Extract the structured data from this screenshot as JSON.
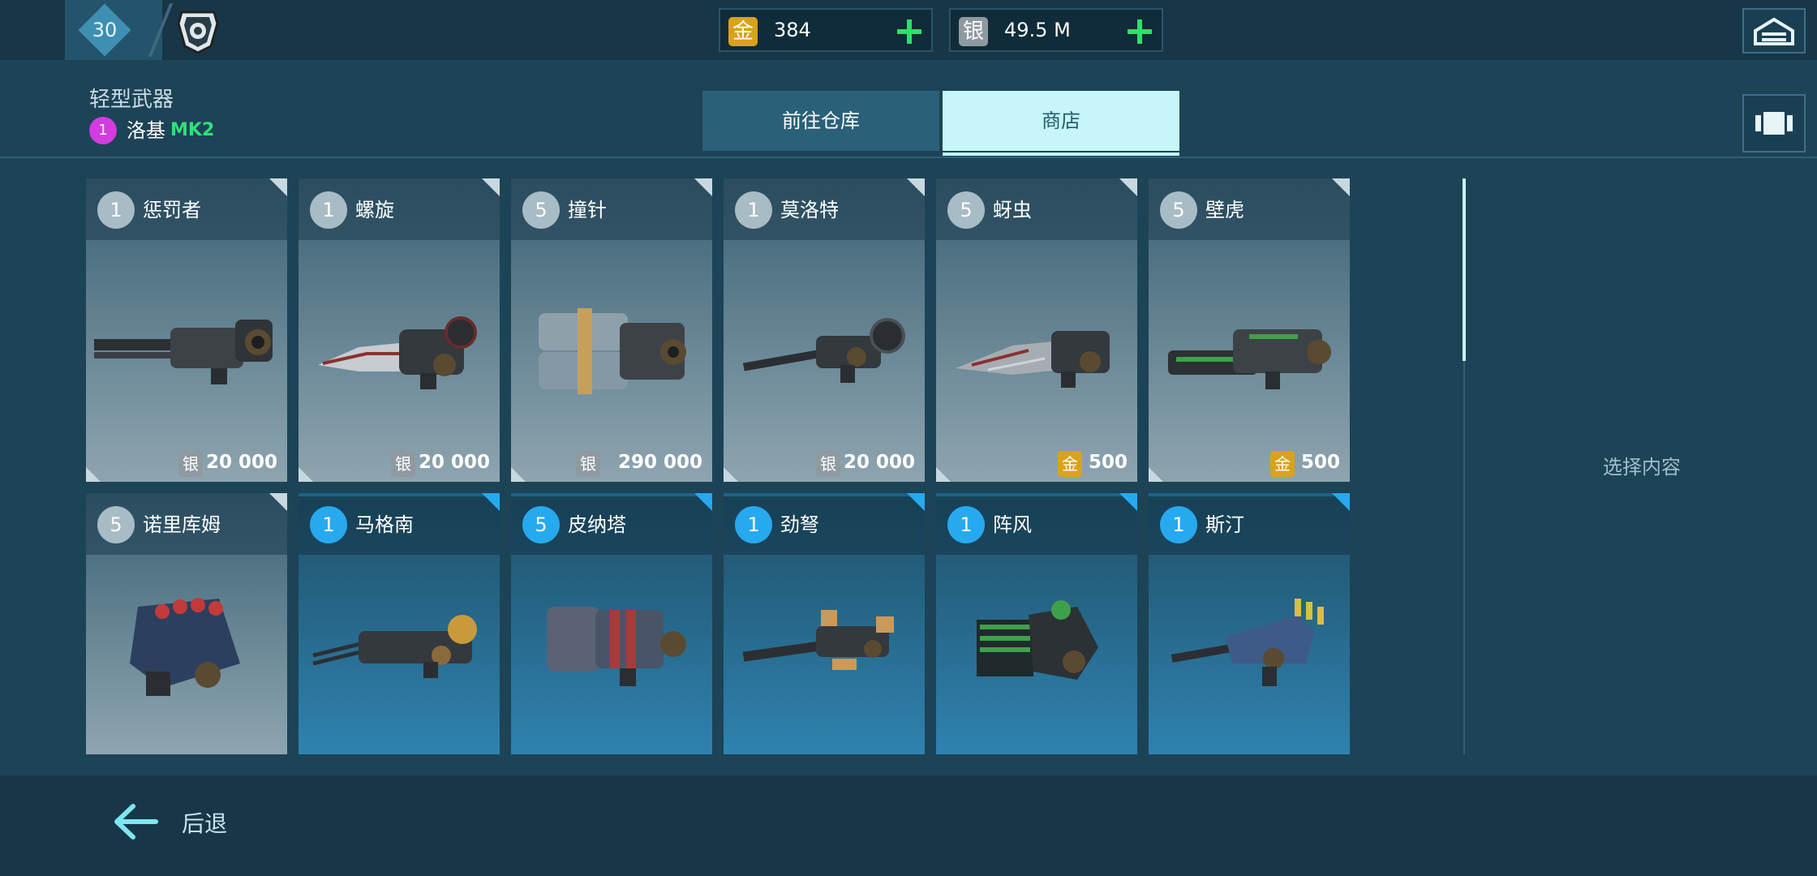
{
  "top": {
    "level": "30",
    "currencies": [
      {
        "coin_char": "金",
        "amount": "384",
        "color": "#d9a21e"
      },
      {
        "coin_char": "银",
        "amount": "49.5 M",
        "color": "#8e9aa0"
      }
    ]
  },
  "category": {
    "title": "轻型武器",
    "badge": "1",
    "name": "洛基",
    "mark": "MK2"
  },
  "tabs": [
    {
      "label": "前往仓库",
      "active": false
    },
    {
      "label": "商店",
      "active": true
    }
  ],
  "cards_row1": [
    {
      "badge": "1",
      "name": "惩罚者",
      "currency": "银",
      "price": "20 000"
    },
    {
      "badge": "1",
      "name": "螺旋",
      "currency": "银",
      "price": "20 000"
    },
    {
      "badge": "5",
      "name": "撞针",
      "currency": "银",
      "price": "290 000"
    },
    {
      "badge": "1",
      "name": "莫洛特",
      "currency": "银",
      "price": "20 000"
    },
    {
      "badge": "5",
      "name": "蚜虫",
      "currency": "金",
      "price": "500"
    },
    {
      "badge": "5",
      "name": "壁虎",
      "currency": "金",
      "price": "500"
    }
  ],
  "cards_row2": [
    {
      "badge": "5",
      "name": "诺里库姆"
    },
    {
      "badge": "1",
      "name": "马格南"
    },
    {
      "badge": "5",
      "name": "皮纳塔"
    },
    {
      "badge": "1",
      "name": "劲弩"
    },
    {
      "badge": "1",
      "name": "阵风"
    },
    {
      "badge": "1",
      "name": "斯汀"
    }
  ],
  "side": {
    "placeholder": "选择内容"
  },
  "bottom": {
    "back_label": "后退"
  },
  "colors": {
    "gold": "#d9a21e",
    "silver": "#8e9aa0",
    "rare_blue": "#27a9ef",
    "accent_green": "#2ee06a"
  }
}
